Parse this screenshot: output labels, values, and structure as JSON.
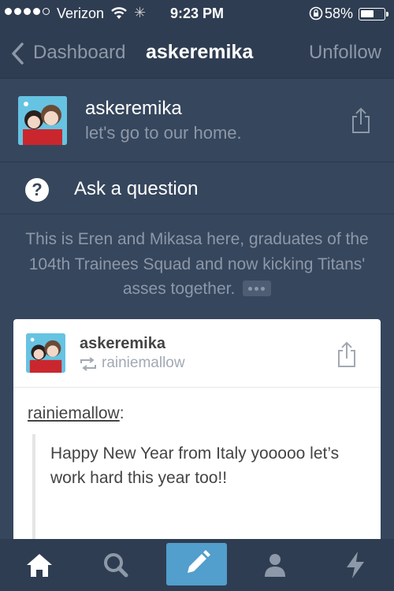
{
  "status_bar": {
    "carrier": "Verizon",
    "time": "9:23 PM",
    "battery_percent": "58%",
    "battery_level": 0.58
  },
  "nav": {
    "back_label": "Dashboard",
    "title": "askeremika",
    "action_label": "Unfollow"
  },
  "blog": {
    "name": "askeremika",
    "description": "let's go to our home.",
    "ask_label": "Ask a question",
    "bio": "This is Eren and Mikasa here, graduates of the 104th Trainees Squad and now kicking Titans' asses together."
  },
  "post": {
    "author": "askeremika",
    "reblogged_from": "rainiemallow",
    "quoted_user": "rainiemallow",
    "quote_text": "Happy New Year from Italy yooooo let’s work hard this year too!!"
  },
  "tab_bar": {
    "items": [
      "home-icon",
      "search-icon",
      "compose-icon",
      "account-icon",
      "activity-icon"
    ],
    "accent": "#529ecc"
  },
  "colors": {
    "background": "#36465d",
    "muted_text": "#8d98a8",
    "card": "#ffffff"
  }
}
